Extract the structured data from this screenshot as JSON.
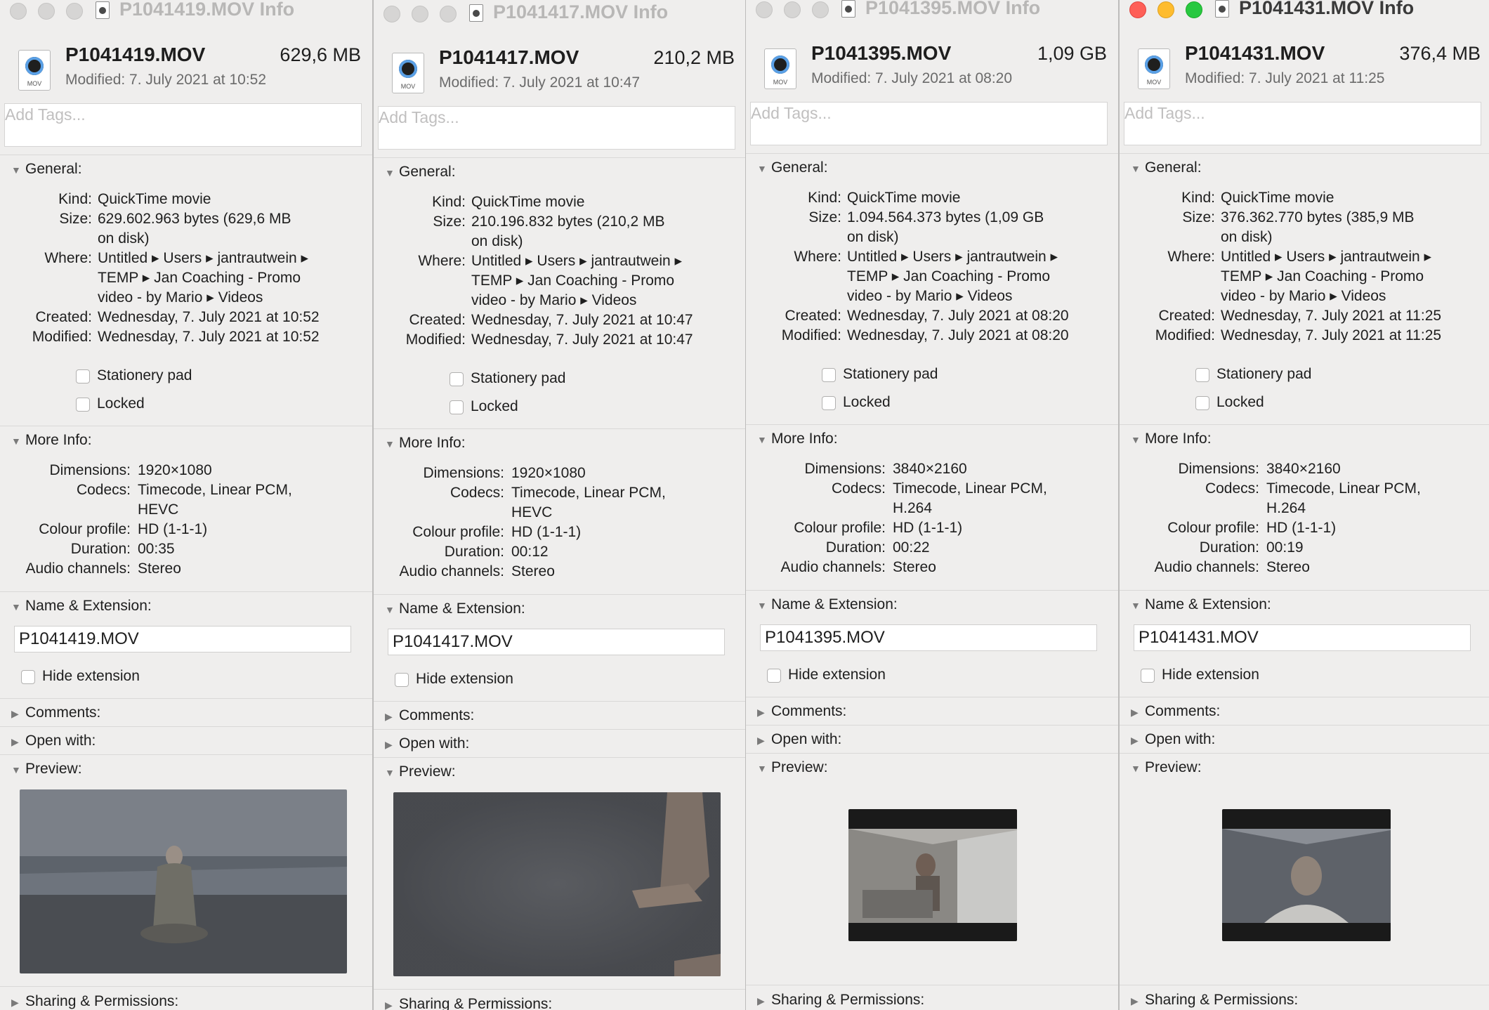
{
  "labels": {
    "add_tags": "Add Tags...",
    "general": "General:",
    "kind": "Kind:",
    "size": "Size:",
    "where": "Where:",
    "created": "Created:",
    "modified": "Modified:",
    "stationery": "Stationery pad",
    "locked": "Locked",
    "more_info": "More Info:",
    "dimensions": "Dimensions:",
    "codecs": "Codecs:",
    "colour_profile": "Colour profile:",
    "duration": "Duration:",
    "audio_channels": "Audio channels:",
    "name_ext": "Name & Extension:",
    "hide_ext": "Hide extension",
    "comments": "Comments:",
    "open_with": "Open with:",
    "preview": "Preview:",
    "sharing": "Sharing & Permissions:",
    "icon_label": "MOV"
  },
  "windows": [
    {
      "title": "P1041419.MOV Info",
      "filename": "P1041419.MOV",
      "size_short": "629,6 MB",
      "modified_short": "Modified: 7. July 2021 at 10:52",
      "kind": "QuickTime movie",
      "size_line1": "629.602.963 bytes (629,6 MB",
      "size_line2": "on disk)",
      "where_line1": "Untitled ▸ Users ▸ jantrautwein ▸",
      "where_line2": "TEMP ▸ Jan Coaching - Promo",
      "where_line3": "video - by Mario ▸ Videos",
      "created": "Wednesday, 7. July 2021 at 10:52",
      "modified": "Wednesday, 7. July 2021 at 10:52",
      "dimensions": "1920×1080",
      "codecs_line1": "Timecode, Linear PCM,",
      "codecs_line2": "HEVC",
      "colour_profile": "HD (1-1-1)",
      "duration": "00:35",
      "audio_channels": "Stereo",
      "name_value": "P1041419.MOV"
    },
    {
      "title": "P1041417.MOV Info",
      "filename": "P1041417.MOV",
      "size_short": "210,2 MB",
      "modified_short": "Modified: 7. July 2021 at 10:47",
      "kind": "QuickTime movie",
      "size_line1": "210.196.832 bytes (210,2 MB",
      "size_line2": "on disk)",
      "where_line1": "Untitled ▸ Users ▸ jantrautwein ▸",
      "where_line2": "TEMP ▸ Jan Coaching - Promo",
      "where_line3": "video - by Mario ▸ Videos",
      "created": "Wednesday, 7. July 2021 at 10:47",
      "modified": "Wednesday, 7. July 2021 at 10:47",
      "dimensions": "1920×1080",
      "codecs_line1": "Timecode, Linear PCM,",
      "codecs_line2": "HEVC",
      "colour_profile": "HD (1-1-1)",
      "duration": "00:12",
      "audio_channels": "Stereo",
      "name_value": "P1041417.MOV"
    },
    {
      "title": "P1041395.MOV Info",
      "filename": "P1041395.MOV",
      "size_short": "1,09 GB",
      "modified_short": "Modified: 7. July 2021 at 08:20",
      "kind": "QuickTime movie",
      "size_line1": "1.094.564.373 bytes (1,09 GB",
      "size_line2": "on disk)",
      "where_line1": "Untitled ▸ Users ▸ jantrautwein ▸",
      "where_line2": "TEMP ▸ Jan Coaching - Promo",
      "where_line3": "video - by Mario ▸ Videos",
      "created": "Wednesday, 7. July 2021 at 08:20",
      "modified": "Wednesday, 7. July 2021 at 08:20",
      "dimensions": "3840×2160",
      "codecs_line1": "Timecode, Linear PCM,",
      "codecs_line2": "H.264",
      "colour_profile": "HD (1-1-1)",
      "duration": "00:22",
      "audio_channels": "Stereo",
      "name_value": "P1041395.MOV"
    },
    {
      "title": "P1041431.MOV Info",
      "filename": "P1041431.MOV",
      "size_short": "376,4 MB",
      "modified_short": "Modified: 7. July 2021 at 11:25",
      "kind": "QuickTime movie",
      "size_line1": "376.362.770 bytes (385,9 MB",
      "size_line2": "on disk)",
      "where_line1": "Untitled ▸ Users ▸ jantrautwein ▸",
      "where_line2": "TEMP ▸ Jan Coaching - Promo",
      "where_line3": "video - by Mario ▸ Videos",
      "created": "Wednesday, 7. July 2021 at 11:25",
      "modified": "Wednesday, 7. July 2021 at 11:25",
      "dimensions": "3840×2160",
      "codecs_line1": "Timecode, Linear PCM,",
      "codecs_line2": "H.264",
      "colour_profile": "HD (1-1-1)",
      "duration": "00:19",
      "audio_channels": "Stereo",
      "name_value": "P1041431.MOV"
    }
  ]
}
